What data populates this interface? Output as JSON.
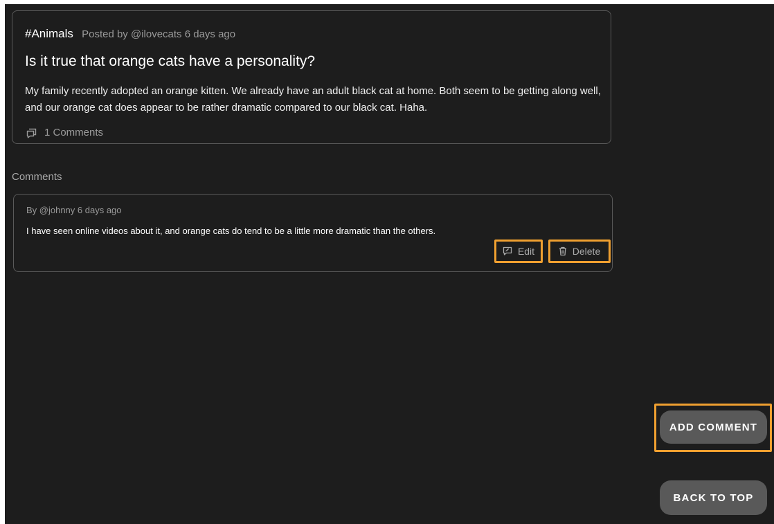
{
  "post": {
    "tag": "#Animals",
    "meta": "Posted by @ilovecats 6 days ago",
    "title": "Is it true that orange cats have a personality?",
    "body": "My family recently adopted an orange kitten. We already have an adult black cat at home. Both seem to be getting along well, and our orange cat does appear to be rather dramatic compared to our black cat. Haha.",
    "comments_count": "1 Comments",
    "comments_icon": "comments-icon"
  },
  "comments_section": {
    "label": "Comments",
    "items": [
      {
        "meta": "By @johnny 6 days ago",
        "text": "I have seen online videos about it, and orange cats do tend to be a little more dramatic than the others.",
        "edit_label": "Edit",
        "edit_icon": "edit-icon",
        "delete_label": "Delete",
        "delete_icon": "trash-icon"
      }
    ]
  },
  "actions": {
    "add_comment": "ADD COMMENT",
    "back_to_top": "BACK TO TOP"
  },
  "colors": {
    "background": "#1d1d1d",
    "highlight": "#f0a030",
    "button_bg": "#595959"
  }
}
